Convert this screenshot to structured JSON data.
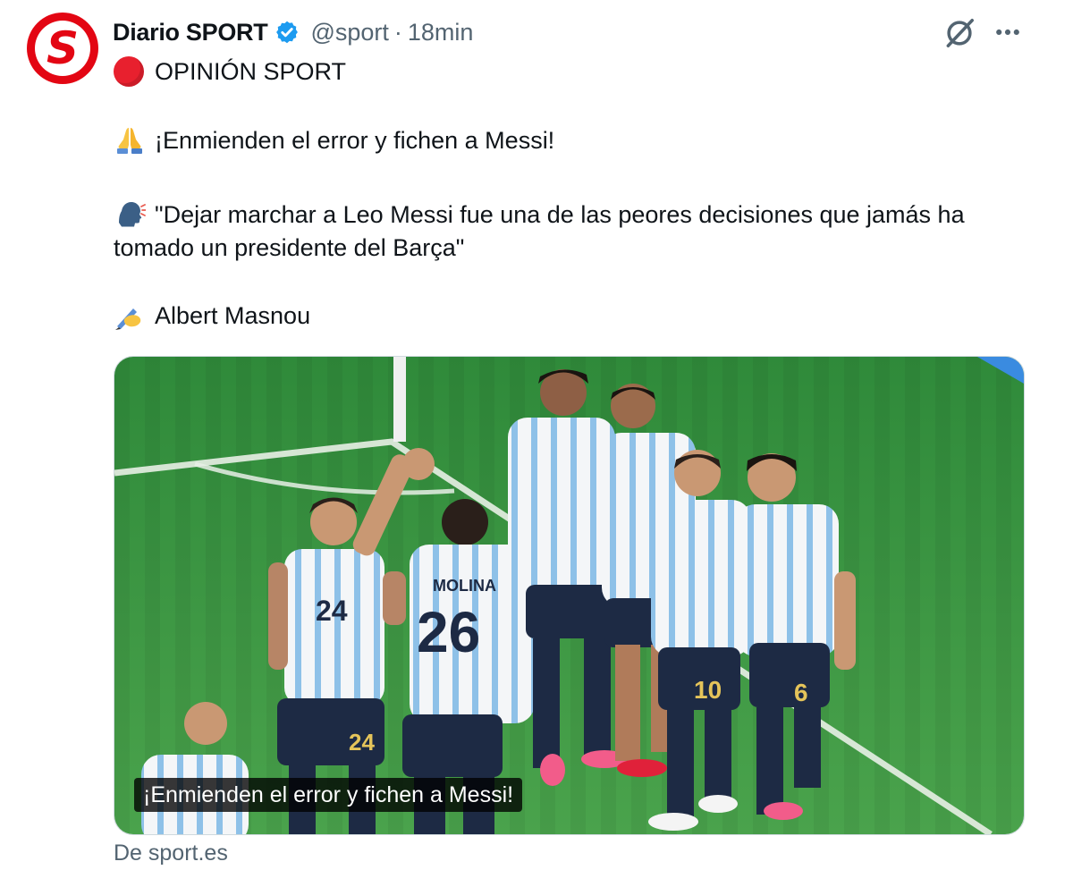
{
  "tweet": {
    "author_name": "Diario SPORT",
    "handle": "@sport",
    "separator": "·",
    "time": "18min",
    "avatar_letter": "S",
    "line1": "OPINIÓN SPORT",
    "line2": "¡Enmienden el error y fichen a Messi!",
    "line3": "\"Dejar marchar a Leo Messi fue una de las peores decisiones que jamás ha tomado un presidente del Barça\"",
    "line4": "Albert Masnou",
    "media_caption": "¡Enmienden el error y fichen a Messi!",
    "source": "De sport.es",
    "jersey_numbers": [
      "24",
      "26",
      "10",
      "6"
    ],
    "jersey_name": "MOLINA"
  },
  "icons": {
    "verified": "verified-badge-icon",
    "grok": "grok-icon",
    "more": "more-options-icon",
    "red_circle": "red-circle-emoji",
    "pray": "folded-hands-emoji",
    "speaking": "speaking-head-emoji",
    "writing": "writing-hand-emoji"
  },
  "colors": {
    "brand_red": "#e30613",
    "verified_blue": "#1d9bf0",
    "secondary_text": "#536471",
    "pitch_green": "#3f9a45"
  }
}
